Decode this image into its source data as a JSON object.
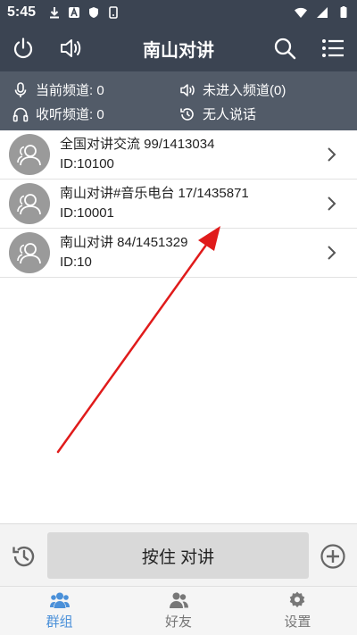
{
  "status_bar": {
    "time": "5:45"
  },
  "app_bar": {
    "title": "南山对讲"
  },
  "info": {
    "current_channel": "当前频道: 0",
    "listen_channel": "收听频道: 0",
    "not_joined": "未进入频道(0)",
    "no_speaker": "无人说话"
  },
  "channels": [
    {
      "name": "全国对讲交流 99/1413034",
      "id": "ID:10100"
    },
    {
      "name": "南山对讲#音乐电台 17/1435871",
      "id": "ID:10001"
    },
    {
      "name": "南山对讲 84/1451329",
      "id": "ID:10"
    }
  ],
  "ptt": {
    "label": "按住 对讲"
  },
  "bottom_nav": {
    "groups": "群组",
    "friends": "好友",
    "settings": "设置"
  },
  "colors": {
    "header_bg": "#3b4452",
    "info_bg": "#525b68",
    "accent": "#4a90d9",
    "annotation_arrow": "#e01b1b"
  }
}
